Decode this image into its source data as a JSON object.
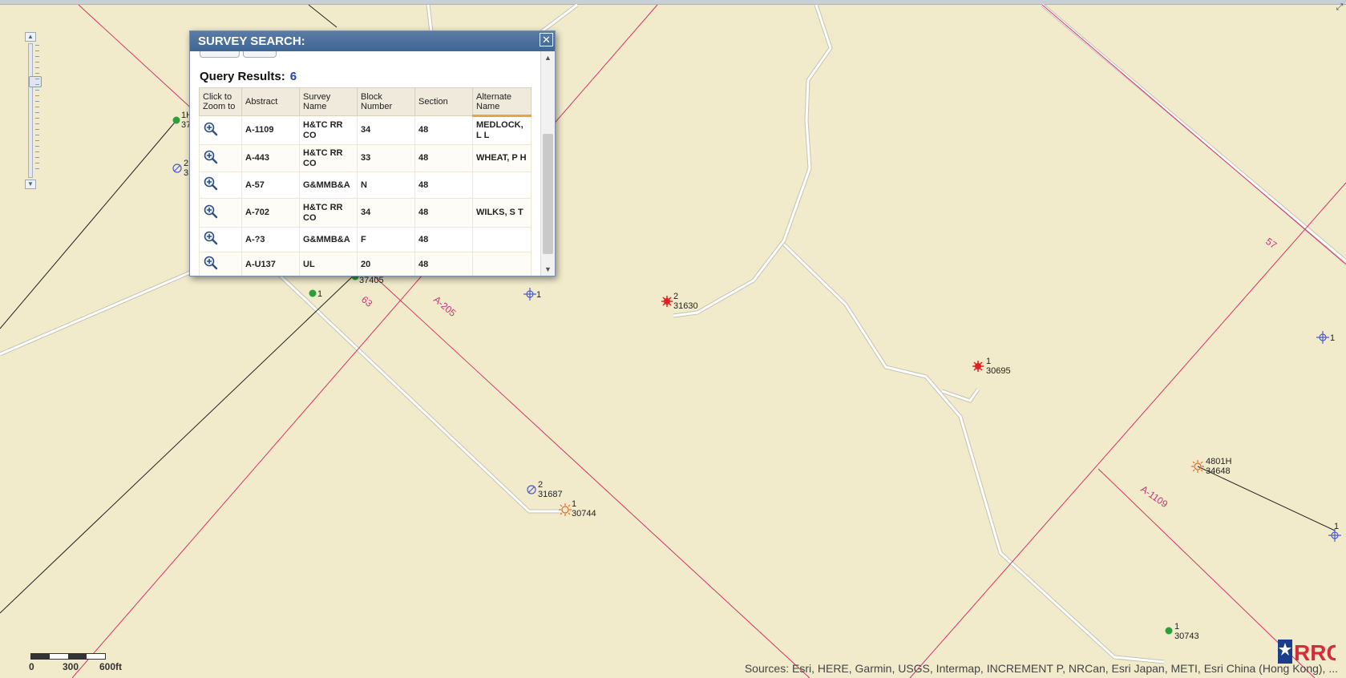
{
  "dialog": {
    "title": "SURVEY SEARCH:",
    "close_symbol": "✕",
    "results_label": "Query Results:",
    "results_count": "6",
    "columns": [
      "Click to Zoom to",
      "Abstract",
      "Survey Name",
      "Block Number",
      "Section",
      "Alternate Name"
    ],
    "rows": [
      {
        "abstract": "A-1109",
        "survey_name": "H&TC RR CO",
        "block": "34",
        "section": "48",
        "alternate": "MEDLOCK, L L"
      },
      {
        "abstract": "A-443",
        "survey_name": "H&TC RR CO",
        "block": "33",
        "section": "48",
        "alternate": "WHEAT, P H"
      },
      {
        "abstract": "A-57",
        "survey_name": "G&MMB&A",
        "block": "N",
        "section": "48",
        "alternate": ""
      },
      {
        "abstract": "A-702",
        "survey_name": "H&TC RR CO",
        "block": "34",
        "section": "48",
        "alternate": "WILKS, S T"
      },
      {
        "abstract": "A-?3",
        "survey_name": "G&MMB&A",
        "block": "F",
        "section": "48",
        "alternate": ""
      },
      {
        "abstract": "A-U137",
        "survey_name": "UL",
        "block": "20",
        "section": "48",
        "alternate": ""
      }
    ]
  },
  "map": {
    "survey_labels": [
      "A-205",
      "A-1109",
      "63",
      "57"
    ],
    "well_labels": [
      {
        "line1": "2",
        "line2": "31630",
        "symbol": "red-star"
      },
      {
        "line1": "1",
        "line2": "30695",
        "symbol": "red-star"
      },
      {
        "line1": "2",
        "line2": "31687",
        "symbol": "plugged-well"
      },
      {
        "line1": "1",
        "line2": "30744",
        "symbol": "orange-sun"
      },
      {
        "line1": "4801H",
        "line2": "34648",
        "symbol": "orange-sun"
      },
      {
        "line1": "1",
        "line2": "30743",
        "symbol": "green-dot"
      },
      {
        "line1": "1",
        "line2": "",
        "symbol": "green-dot"
      },
      {
        "line1": "1",
        "line2": "",
        "symbol": "blue-cross"
      },
      {
        "line1": "1",
        "line2": "",
        "symbol": "blue-cross"
      },
      {
        "line1": "1",
        "line2": "",
        "symbol": "blue-cross"
      },
      {
        "line1": "1H",
        "line2": "37",
        "symbol": "green-dot"
      },
      {
        "line1": "2",
        "line2": "3",
        "symbol": "plugged-well"
      },
      {
        "line1": "",
        "line2": "37405",
        "symbol": "green-dot"
      }
    ],
    "scale": {
      "labels": [
        "0",
        "300",
        "600ft"
      ]
    },
    "attribution": "Sources: Esri, HERE, Garmin, USGS, Intermap, INCREMENT P, NRCan, Esri Japan, METI, Esri China (Hong Kong), ...",
    "logo_text": "RRC",
    "zoom_in_symbol": "▲",
    "zoom_out_symbol": "▼",
    "expand_symbol": "⤢"
  },
  "colors": {
    "map_background": "#f1ebcb",
    "survey_line": "#d0326b",
    "survey_label": "#c8327a",
    "road": "#ffffff",
    "dialog_header": "#4a6f9c",
    "results_count": "#1f3fbf"
  }
}
